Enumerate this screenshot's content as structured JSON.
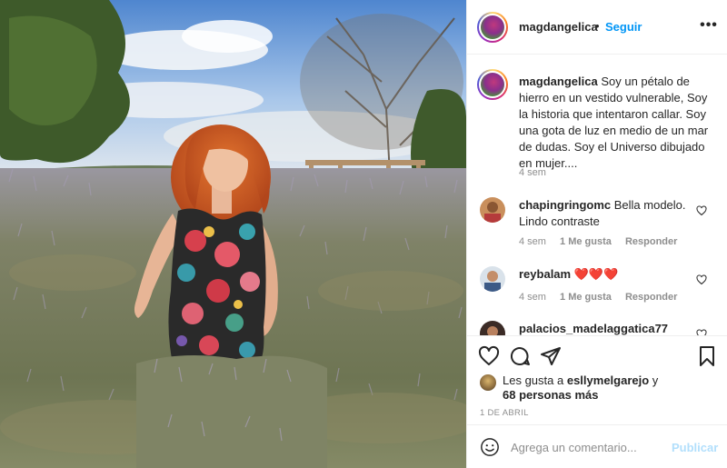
{
  "post": {
    "username": "magdangelica",
    "follow_label": "Seguir",
    "more_label": "•••",
    "caption_text": "Soy un pétalo de hierro en un vestido vulnerable, Soy la historia que intentaron callar. Soy una gota de luz en medio de un mar de dudas. Soy el Universo dibujado en mujer....",
    "caption_time": "4 sem"
  },
  "comments": [
    {
      "username": "chapingringomc",
      "text": "Bella modelo. Lindo contraste",
      "time": "4 sem",
      "likes": "1 Me gusta",
      "reply": "Responder"
    },
    {
      "username": "reybalam",
      "text": "❤️❤️❤️",
      "time": "4 sem",
      "likes": "1 Me gusta",
      "reply": "Responder"
    },
    {
      "username": "palacios_madelaggatica77",
      "text": ""
    }
  ],
  "likes": {
    "prefix": "Les gusta a",
    "first_user": "esllymelgarejo",
    "suffix": "y",
    "others": "68 personas más"
  },
  "date": "1 DE ABRIL",
  "add_comment": {
    "placeholder": "Agrega un comentario...",
    "post_label": "Publicar"
  },
  "icons": {
    "like": "heart-icon",
    "comment": "comment-icon",
    "share": "paper-plane-icon",
    "save": "bookmark-icon",
    "emoji": "smiley-icon",
    "more": "more-options-icon"
  },
  "colors": {
    "accent": "#0095f6",
    "post_disabled": "#b2dffc",
    "muted_text": "#8e8e8e",
    "text": "#262626"
  }
}
